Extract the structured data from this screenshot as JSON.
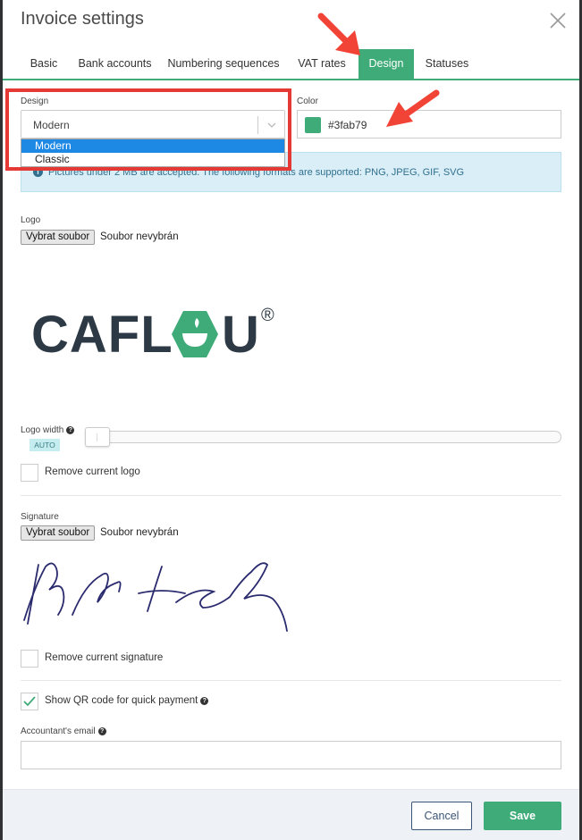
{
  "modal": {
    "title": "Invoice settings"
  },
  "tabs": [
    {
      "label": "Basic"
    },
    {
      "label": "Bank accounts"
    },
    {
      "label": "Numbering sequences"
    },
    {
      "label": "VAT rates"
    },
    {
      "label": "Design"
    },
    {
      "label": "Statuses"
    }
  ],
  "active_tab": "Design",
  "design": {
    "label": "Design",
    "selected": "Modern",
    "options": [
      "Modern",
      "Classic"
    ]
  },
  "color": {
    "label": "Color",
    "value": "#3fab79",
    "swatch": "#3fab79"
  },
  "alert": {
    "icon": "info-icon",
    "text": "Pictures under 2 MB are accepted. The following formats are supported: PNG, JPEG, GIF, SVG"
  },
  "logo": {
    "label": "Logo",
    "file_button": "Vybrat soubor",
    "file_status": "Soubor nevybrán",
    "brand_left": "CAFL",
    "brand_right": "U",
    "brand_mark": "®",
    "brand_color": "#2d3a45",
    "brand_accent": "#3fab79"
  },
  "logo_width": {
    "label": "Logo width",
    "badge": "AUTO",
    "help_icon": "question-circle-icon"
  },
  "remove_logo": {
    "label": "Remove current logo",
    "checked": false
  },
  "signature": {
    "label": "Signature",
    "file_button": "Vybrat soubor",
    "file_status": "Soubor nevybrán"
  },
  "remove_signature": {
    "label": "Remove current signature",
    "checked": false
  },
  "qr_code": {
    "label": "Show QR code for quick payment",
    "checked": true,
    "help_icon": "question-circle-icon"
  },
  "accountant_email": {
    "label": "Accountant's email",
    "value": "",
    "help_icon": "question-circle-icon"
  },
  "footer": {
    "cancel_label": "Cancel",
    "save_label": "Save"
  },
  "annotation_color": "#e53935"
}
